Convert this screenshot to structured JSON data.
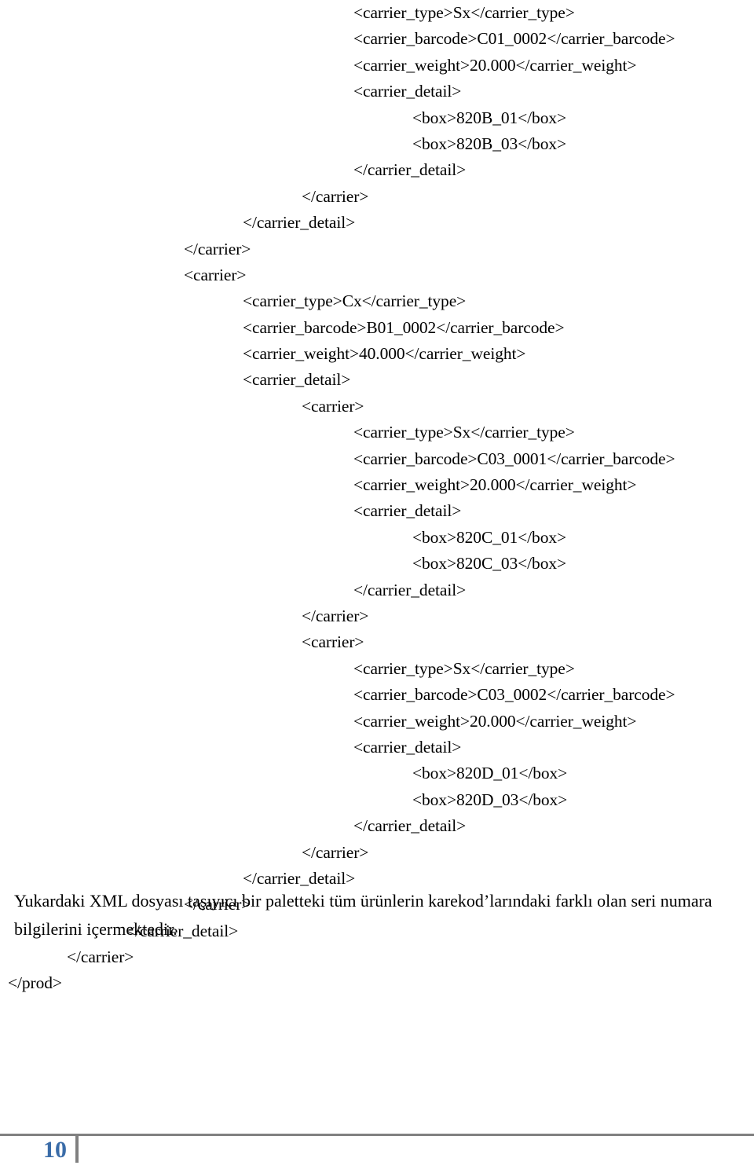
{
  "document": {
    "page_number": "10",
    "code_block": {
      "language": "xml",
      "lines": [
        {
          "indent": 6,
          "text": "<carrier_type>Sx</carrier_type>"
        },
        {
          "indent": 6,
          "text": "<carrier_barcode>C01_0002</carrier_barcode>"
        },
        {
          "indent": 6,
          "text": "<carrier_weight>20.000</carrier_weight>"
        },
        {
          "indent": 6,
          "text": "<carrier_detail>"
        },
        {
          "indent": 7,
          "text": "<box>820B_01</box>"
        },
        {
          "indent": 7,
          "text": "<box>820B_03</box>"
        },
        {
          "indent": 6,
          "text": "</carrier_detail>"
        },
        {
          "indent": 5,
          "text": "</carrier>"
        },
        {
          "indent": 4,
          "text": "</carrier_detail>"
        },
        {
          "indent": 3,
          "text": "</carrier>"
        },
        {
          "indent": 3,
          "text": "<carrier>"
        },
        {
          "indent": 4,
          "text": "<carrier_type>Cx</carrier_type>"
        },
        {
          "indent": 4,
          "text": "<carrier_barcode>B01_0002</carrier_barcode>"
        },
        {
          "indent": 4,
          "text": "<carrier_weight>40.000</carrier_weight>"
        },
        {
          "indent": 4,
          "text": "<carrier_detail>"
        },
        {
          "indent": 5,
          "text": "<carrier>"
        },
        {
          "indent": 6,
          "text": "<carrier_type>Sx</carrier_type>"
        },
        {
          "indent": 6,
          "text": "<carrier_barcode>C03_0001</carrier_barcode>"
        },
        {
          "indent": 6,
          "text": "<carrier_weight>20.000</carrier_weight>"
        },
        {
          "indent": 6,
          "text": "<carrier_detail>"
        },
        {
          "indent": 7,
          "text": "<box>820C_01</box>"
        },
        {
          "indent": 7,
          "text": "<box>820C_03</box>"
        },
        {
          "indent": 6,
          "text": "</carrier_detail>"
        },
        {
          "indent": 5,
          "text": "</carrier>"
        },
        {
          "indent": 5,
          "text": "<carrier>"
        },
        {
          "indent": 6,
          "text": "<carrier_type>Sx</carrier_type>"
        },
        {
          "indent": 6,
          "text": "<carrier_barcode>C03_0002</carrier_barcode>"
        },
        {
          "indent": 6,
          "text": "<carrier_weight>20.000</carrier_weight>"
        },
        {
          "indent": 6,
          "text": "<carrier_detail>"
        },
        {
          "indent": 7,
          "text": "<box>820D_01</box>"
        },
        {
          "indent": 7,
          "text": "<box>820D_03</box>"
        },
        {
          "indent": 6,
          "text": "</carrier_detail>"
        },
        {
          "indent": 5,
          "text": "</carrier>"
        },
        {
          "indent": 4,
          "text": "</carrier_detail>"
        },
        {
          "indent": 3,
          "text": "</carrier>"
        },
        {
          "indent": 2,
          "text": "</carrier_detail>"
        },
        {
          "indent": 1,
          "text": "</carrier>"
        },
        {
          "indent": 0,
          "text": "</prod>"
        }
      ]
    },
    "note_paragraph": "Yukardaki XML dosyası taşıyıcı bir paletteki tüm ürünlerin karekod’larındaki farklı olan seri numara bilgilerini içermektedir."
  }
}
